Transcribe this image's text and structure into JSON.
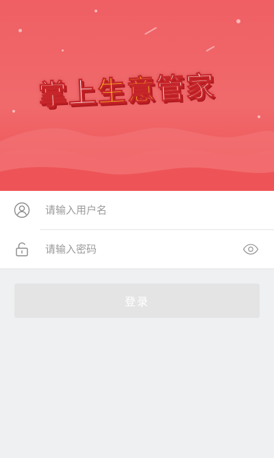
{
  "banner": {
    "title_parts": [
      {
        "text": "掌上",
        "style": "white"
      },
      {
        "text": "生意",
        "style": "yellow"
      },
      {
        "text": "管家",
        "style": "white"
      }
    ],
    "colors": {
      "background": "#f06a6c",
      "title_white": "#ffffff",
      "title_yellow": "#ffd523"
    }
  },
  "form": {
    "username": {
      "icon": "user-icon",
      "value": "",
      "placeholder": "请输入用户名"
    },
    "password": {
      "icon": "unlock-icon",
      "value": "",
      "placeholder": "请输入密码",
      "toggle_icon": "eye-icon"
    }
  },
  "login": {
    "label": "登录",
    "enabled": false
  }
}
